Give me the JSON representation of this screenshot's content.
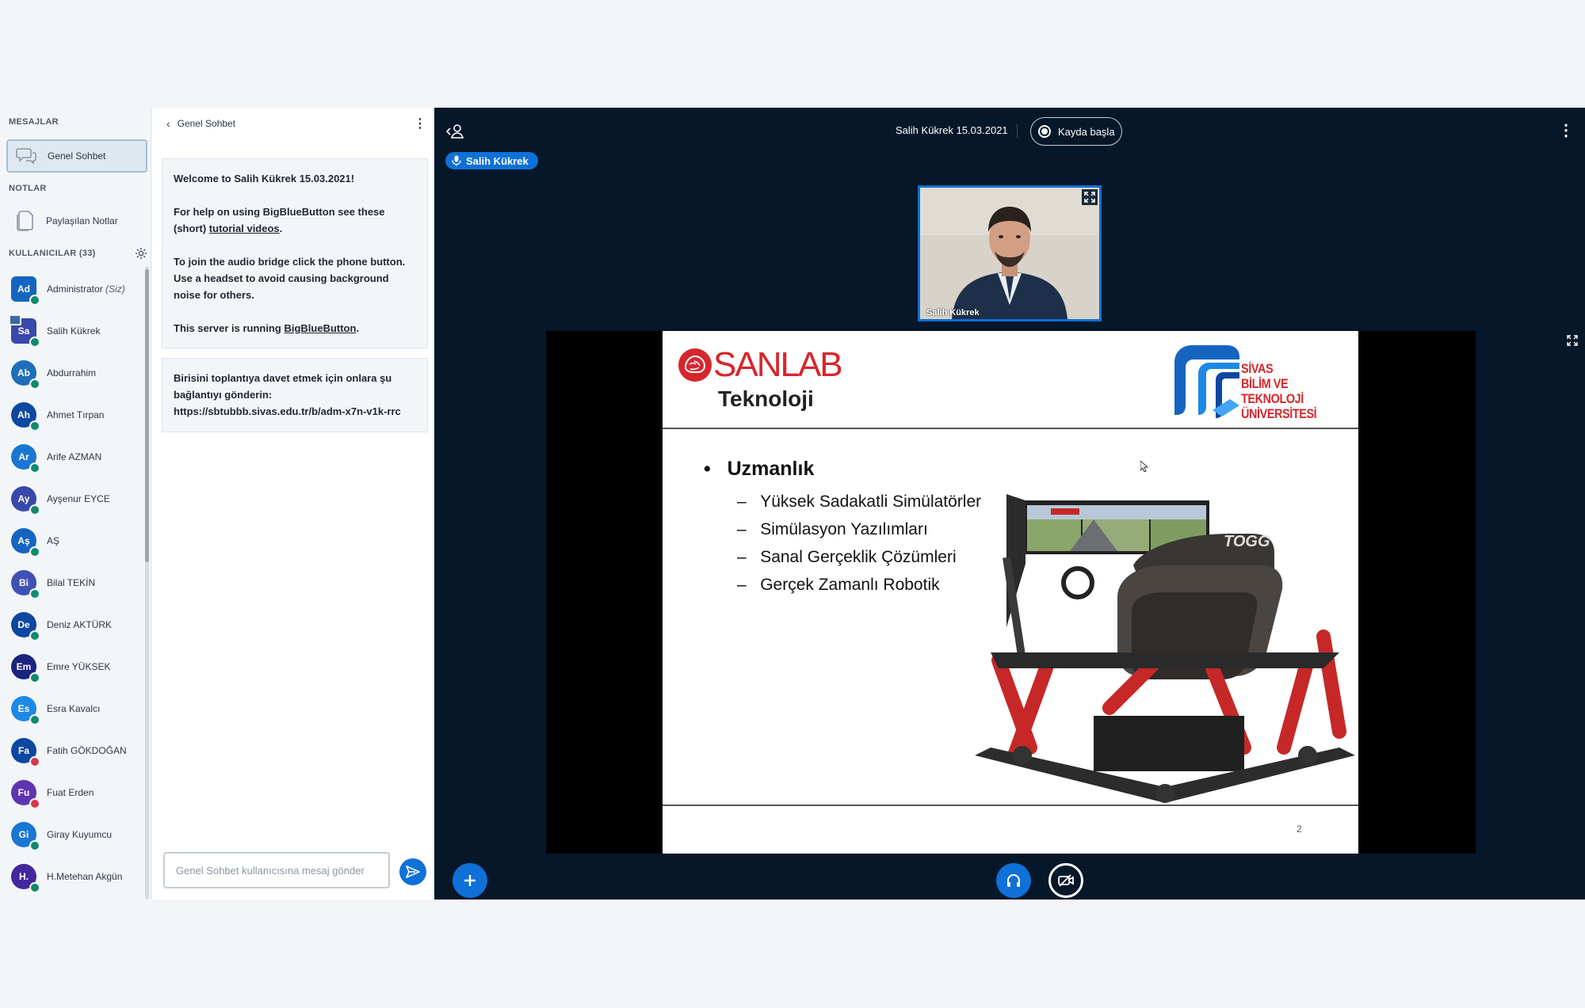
{
  "sidebar": {
    "messages_title": "MESAJLAR",
    "public_chat_label": "Genel Sohbet",
    "notes_title": "NOTLAR",
    "shared_notes_label": "Paylaşılan Notlar",
    "users_title": "KULLANICILAR (33)",
    "users": [
      {
        "initials": "Ad",
        "name": "Administrator",
        "suffix": "(Siz)",
        "color": "#1565c0",
        "shape": "square",
        "status": "listen"
      },
      {
        "initials": "Sa",
        "name": "Salih Kükrek",
        "color": "#3949ab",
        "shape": "square",
        "status": "listen",
        "presenter": true
      },
      {
        "initials": "Ab",
        "name": "Abdurrahim",
        "color": "#1e6fb8",
        "shape": "round",
        "status": "listen"
      },
      {
        "initials": "Ah",
        "name": "Ahmet Tırpan",
        "color": "#0d47a1",
        "shape": "round",
        "status": "listen"
      },
      {
        "initials": "Ar",
        "name": "Arife AZMAN",
        "color": "#1976d2",
        "shape": "round",
        "status": "listen"
      },
      {
        "initials": "Ay",
        "name": "Ayşenur EYCE",
        "color": "#3949ab",
        "shape": "round",
        "status": "listen"
      },
      {
        "initials": "Aş",
        "name": "AŞ",
        "color": "#1565c0",
        "shape": "round",
        "status": "listen"
      },
      {
        "initials": "Bi",
        "name": "Bilal TEKİN",
        "color": "#3f51b5",
        "shape": "round",
        "status": "listen"
      },
      {
        "initials": "De",
        "name": "Deniz AKTÜRK",
        "color": "#0d47a1",
        "shape": "round",
        "status": "listen"
      },
      {
        "initials": "Em",
        "name": "Emre YÜKSEK",
        "color": "#1a237e",
        "shape": "round",
        "status": "listen"
      },
      {
        "initials": "Es",
        "name": "Esra Kavalcı",
        "color": "#1e88e5",
        "shape": "round",
        "status": "listen"
      },
      {
        "initials": "Fa",
        "name": "Fatih GÖKDOĞAN",
        "color": "#0d47a1",
        "shape": "round",
        "status": "muted"
      },
      {
        "initials": "Fu",
        "name": "Fuat Erden",
        "color": "#5e35b1",
        "shape": "round",
        "status": "muted"
      },
      {
        "initials": "Gi",
        "name": "Giray Kuyumcu",
        "color": "#1976d2",
        "shape": "round",
        "status": "listen"
      },
      {
        "initials": "H.",
        "name": "H.Metehan Akgün",
        "color": "#4527a0",
        "shape": "round",
        "status": "listen"
      }
    ]
  },
  "chat": {
    "title": "Genel Sohbet",
    "welcome_title": "Welcome to Salih Kükrek 15.03.2021!",
    "help_prefix": "For help on using BigBlueButton see these (short)",
    "help_link": "tutorial videos",
    "help_suffix": ".",
    "audio_text": "To join the audio bridge click the phone button. Use a headset to avoid causing background noise for others.",
    "server_prefix": "This server is running",
    "server_link": "BigBlueButton",
    "server_suffix": ".",
    "invite_text": "Birisini toplantıya davet etmek için onlara şu bağlantıyı gönderin:",
    "invite_url": "https://sbtubbb.sivas.edu.tr/b/adm-x7n-v1k-rrc",
    "input_placeholder": "Genel Sohbet kullanıcısına mesaj gönder"
  },
  "stage": {
    "meeting_title": "Salih Kükrek 15.03.2021",
    "record_label": "Kayda başla",
    "talker_name": "Salih Kükrek",
    "video_name": "Salih Kükrek"
  },
  "slide": {
    "logo_text": "SANLAB",
    "title": "Teknoloji",
    "uni_line1": "SİVAS",
    "uni_line2": "BİLİM VE TEKNOLOJİ",
    "uni_line3": "ÜNİVERSİTESİ",
    "bullet": "Uzmanlık",
    "sub_items": [
      "Yüksek Sadakatli Simülatörler",
      "Simülasyon Yazılımları",
      "Sanal Gerçeklik Çözümleri",
      "Gerçek Zamanlı Robotik"
    ],
    "sim_brand": "TOGG",
    "page_number": "2"
  }
}
